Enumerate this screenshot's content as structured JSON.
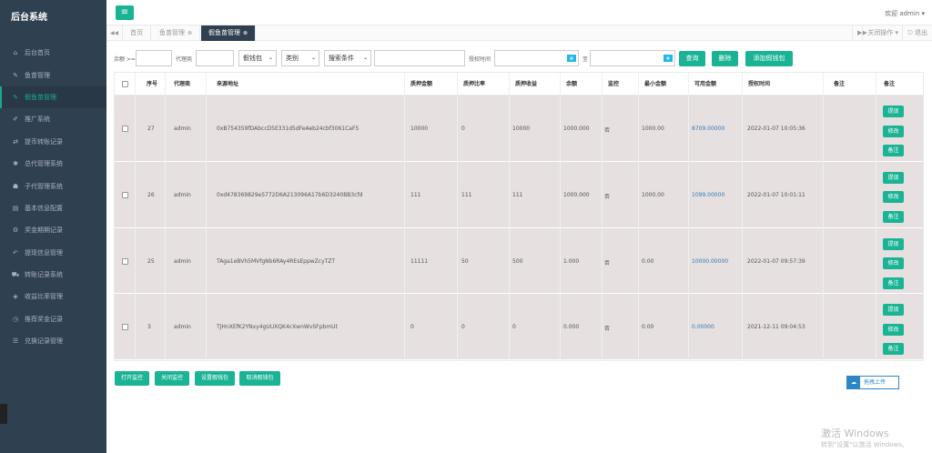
{
  "brand": "后台系统",
  "sidebar": [
    {
      "label": "后台首页",
      "icon": "home-icon",
      "glyph": "⌂"
    },
    {
      "label": "鱼苗管理",
      "icon": "wrench-icon",
      "glyph": "✎"
    },
    {
      "label": "假鱼苗管理",
      "icon": "wrench-icon",
      "glyph": "✎",
      "active": true
    },
    {
      "label": "推广系统",
      "icon": "edit-icon",
      "glyph": "✐"
    },
    {
      "label": "提币转账记录",
      "icon": "shuffle-icon",
      "glyph": "⇄"
    },
    {
      "label": "总代管理系统",
      "icon": "gear-icon",
      "glyph": "✱"
    },
    {
      "label": "子代管理系统",
      "icon": "users-icon",
      "glyph": "☗"
    },
    {
      "label": "基本信息配置",
      "icon": "file-icon",
      "glyph": "▤"
    },
    {
      "label": "奖金期期记录",
      "icon": "gears-icon",
      "glyph": "⚙"
    },
    {
      "label": "提现信息管理",
      "icon": "reply-icon",
      "glyph": "↶"
    },
    {
      "label": "转账记录系统",
      "icon": "car-icon",
      "glyph": "⛟"
    },
    {
      "label": "收益比率管理",
      "icon": "shield-icon",
      "glyph": "◈"
    },
    {
      "label": "推荐奖金记录",
      "icon": "clock-icon",
      "glyph": "◷"
    },
    {
      "label": "兑换记录管理",
      "icon": "list-icon",
      "glyph": "☰"
    }
  ],
  "header": {
    "welcome": "欢迎 admin ▾"
  },
  "tabs": {
    "home": "首页",
    "fish": "鱼苗管理",
    "fake": "假鱼苗管理",
    "close_ops": "关闭操作 ▾",
    "logout": "⎋ 退出"
  },
  "filters": {
    "balance_label": "余额 >=",
    "agent_label": "代理商",
    "wallet_select": "假钱包",
    "category_select": "类别",
    "search_select": "搜索条件",
    "auth_time_label": "授权时间",
    "to_label": "至",
    "query": "查询",
    "delete": "删除",
    "add": "添加假钱包"
  },
  "columns": [
    "序号",
    "代理商",
    "来源地址",
    "质押金额",
    "质押比率",
    "质押收益",
    "余额",
    "监控",
    "最小金额",
    "可用金额",
    "授权时间",
    "备注",
    "备注"
  ],
  "rows": [
    {
      "id": "27",
      "agent": "admin",
      "address": "0xB754359fDAbccD5E331d5dFeAeb24cbf3061CaF5",
      "amount": "10000",
      "ratio": "0",
      "income": "10000",
      "balance": "1000.000",
      "monitor": "否",
      "min": "1000.00",
      "available": "8709.00000",
      "time": "2022-01-07 10:05:36"
    },
    {
      "id": "26",
      "agent": "admin",
      "address": "0xd478369829e5772D6A213096A17b6D3240BB3cfd",
      "amount": "111",
      "ratio": "111",
      "income": "111",
      "balance": "1000.000",
      "monitor": "否",
      "min": "1000.00",
      "available": "1099.00000",
      "time": "2022-01-07 10:01:11"
    },
    {
      "id": "25",
      "agent": "admin",
      "address": "TAga1eBVh5MVfgNb6RAy4REsEppwZcyTZT",
      "amount": "11111",
      "ratio": "50",
      "income": "500",
      "balance": "1.000",
      "monitor": "否",
      "min": "0.00",
      "available": "10000.00000",
      "time": "2022-01-07 09:57:39"
    },
    {
      "id": "3",
      "agent": "admin",
      "address": "TJHnXEfK2YNxy4gUUXQK4cXwnWvSFpbmUt",
      "amount": "0",
      "ratio": "0",
      "income": "0",
      "balance": "0.000",
      "monitor": "否",
      "min": "0.00",
      "available": "0.00000",
      "time": "2021-12-11 09:04:53"
    }
  ],
  "row_actions": [
    "提现",
    "修改",
    "备注"
  ],
  "bottom_buttons": [
    "打开监控",
    "关闭监控",
    "设置假钱包",
    "取消假钱包"
  ],
  "upload": "拖拽上传",
  "watermark": {
    "line1": "激活 Windows",
    "line2": "转到\"设置\"以激活 Windows。"
  },
  "colors": {
    "sidebar": "#2f4050",
    "accent": "#1ab394",
    "row_bg": "#e6e0e0",
    "link": "#337ab7"
  }
}
